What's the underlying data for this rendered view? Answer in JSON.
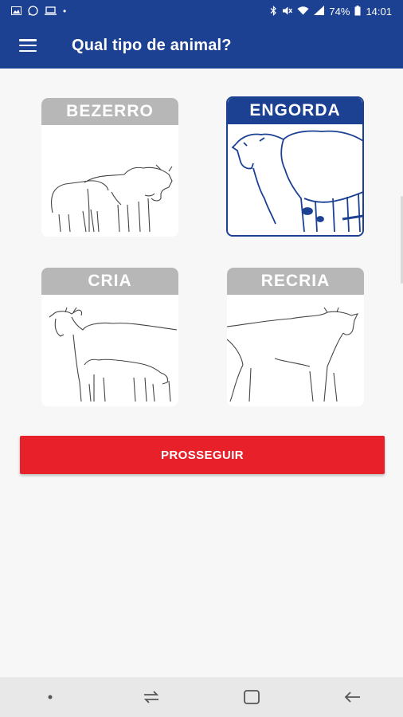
{
  "status": {
    "battery": "74%",
    "time": "14:01",
    "left_icons": [
      "image-icon",
      "whatsapp-icon",
      "laptop-icon",
      "dot-icon"
    ],
    "right_icons": [
      "bluetooth-icon",
      "mute-icon",
      "wifi-icon",
      "signal-icon",
      "battery-icon"
    ]
  },
  "header": {
    "title": "Qual tipo de animal?",
    "menu_icon": "hamburger-menu-icon"
  },
  "options": [
    {
      "label": "BEZERRO",
      "selected": false
    },
    {
      "label": "ENGORDA",
      "selected": true
    },
    {
      "label": "CRIA",
      "selected": false
    },
    {
      "label": "RECRIA",
      "selected": false
    }
  ],
  "actions": {
    "proceed_label": "PROSSEGUIR"
  },
  "colors": {
    "primary": "#1c4193",
    "accent": "#e8202a",
    "label_inactive": "#b7b7b7"
  },
  "nav": [
    "dot-icon",
    "recent-apps-icon",
    "home-icon",
    "back-icon"
  ]
}
